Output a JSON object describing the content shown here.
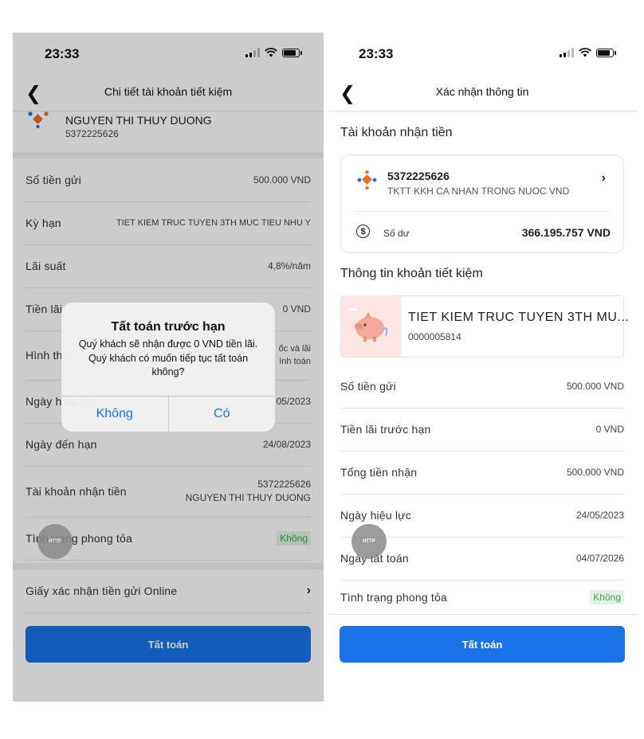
{
  "left": {
    "status": {
      "time": "23:33"
    },
    "nav": {
      "title": "Chi tiết tài khoản tiết kiệm"
    },
    "account": {
      "name": "NGUYEN THI THUY DUONG",
      "number": "5372225626"
    },
    "rows": [
      {
        "label": "Số tiền gửi",
        "value": "500.000 VND"
      },
      {
        "label": "Kỳ hạn",
        "value": "TIET KIEM TRUC TUYEN 3TH MUC TIEU NHU Y"
      },
      {
        "label": "Lãi suất",
        "value": "4,8%/năm"
      },
      {
        "label": "Tiền lãi",
        "value": "0 VND"
      },
      {
        "label": "Hình thức",
        "value_line1": "ốc và lãi",
        "value_line2": "ính toán"
      },
      {
        "label": "Ngày hiệu lực",
        "value": "05/2023"
      },
      {
        "label": "Ngày đến hạn",
        "value": "24/08/2023"
      }
    ],
    "receive": {
      "label": "Tài khoản nhận tiền",
      "number": "5372225626",
      "name": "NGUYEN THI THUY DUONG"
    },
    "block": {
      "label": "Tình trạng phong tỏa",
      "value": "Không"
    },
    "online": {
      "label": "Giấy xác nhận tiền gửi Online"
    },
    "button": "Tất toán",
    "dialog": {
      "title": "Tất toán trước hạn",
      "message": "Quý khách sẽ nhận được 0 VND tiền lãi. Quý khách có muốn tiếp tục tất toán không?",
      "no": "Không",
      "yes": "Có"
    },
    "http": "HTTP"
  },
  "right": {
    "status": {
      "time": "23:33"
    },
    "nav": {
      "title": "Xác nhận thông tin"
    },
    "receive_section": "Tài khoản nhận tiền",
    "account_card": {
      "number": "5372225626",
      "type": "TKTT KKH CA NHAN TRONG NUOC VND",
      "balance_label": "Số dư",
      "balance": "366.195.757 VND"
    },
    "savings_section": "Thông tin khoản tiết kiệm",
    "savings_card": {
      "name": "TIET KIEM TRUC TUYEN 3TH MU...",
      "number": "0000005814"
    },
    "rows": [
      {
        "label": "Số tiền gửi",
        "value": "500.000 VND"
      },
      {
        "label": "Tiền lãi trước hạn",
        "value": "0 VND"
      },
      {
        "label": "Tổng tiền nhận",
        "value": "500.000 VND"
      },
      {
        "label": "Ngày hiệu lực",
        "value": "24/05/2023"
      },
      {
        "label": "Ngày tất toán",
        "value": "04/07/2026"
      },
      {
        "label": "Tình trạng phong tỏa",
        "value": "Không"
      }
    ],
    "button": "Tất toán",
    "http": "HTTP"
  },
  "colors": {
    "primary": "#1a73e8",
    "badge_bg": "#e3f5e6",
    "badge_text": "#3ca24f",
    "logo_orange": "#f26b22"
  }
}
